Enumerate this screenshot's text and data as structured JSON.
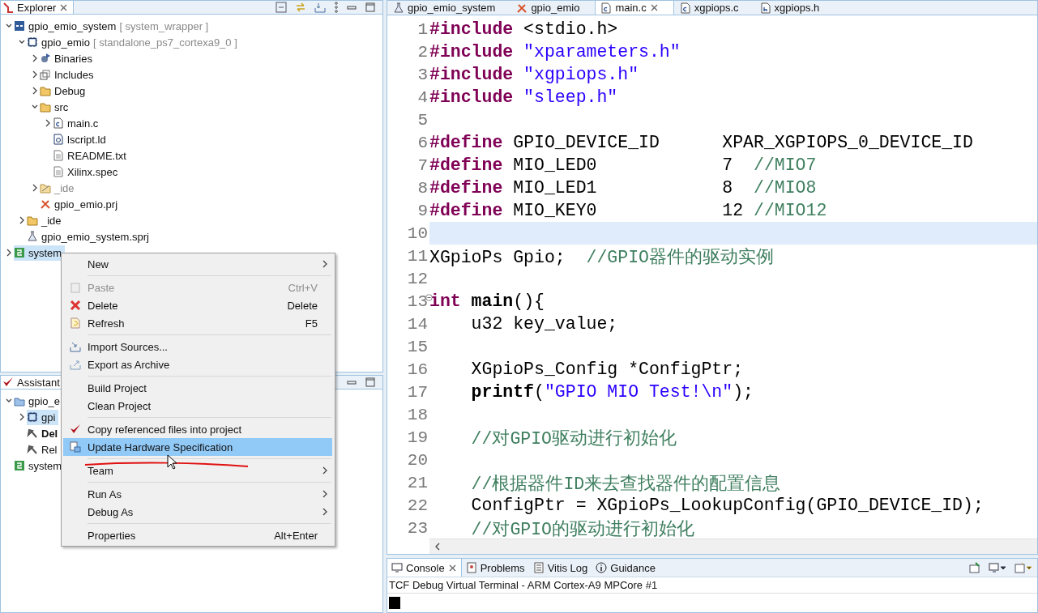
{
  "explorer": {
    "title": "Explorer",
    "tree": [
      {
        "label": "gpio_emio_system",
        "suffix": "[ system_wrapper ]",
        "kind": "system",
        "expanded": true,
        "selected": false,
        "children": [
          {
            "label": "gpio_emio",
            "suffix": "[ standalone_ps7_cortexa9_0 ]",
            "kind": "app",
            "expanded": true,
            "selected": false,
            "children": [
              {
                "label": "Binaries",
                "kind": "binaries",
                "expanded": false,
                "selected": false
              },
              {
                "label": "Includes",
                "kind": "includes",
                "expanded": false,
                "selected": false
              },
              {
                "label": "Debug",
                "kind": "folder",
                "expanded": false,
                "selected": false
              },
              {
                "label": "src",
                "kind": "folder",
                "expanded": true,
                "selected": false,
                "children": [
                  {
                    "label": "main.c",
                    "kind": "cfile",
                    "expanded": false,
                    "selected": false
                  },
                  {
                    "label": "lscript.ld",
                    "kind": "ldfile",
                    "selected": false
                  },
                  {
                    "label": "README.txt",
                    "kind": "textfile",
                    "selected": false
                  },
                  {
                    "label": "Xilinx.spec",
                    "kind": "textfile",
                    "selected": false
                  }
                ]
              },
              {
                "label": "_ide",
                "kind": "idefolder",
                "expanded": false,
                "selected": false
              },
              {
                "label": "gpio_emio.prj",
                "kind": "prj",
                "selected": false
              }
            ]
          },
          {
            "label": "_ide",
            "kind": "folder",
            "expanded": false,
            "selected": false
          },
          {
            "label": "gpio_emio_system.sprj",
            "kind": "sprj",
            "selected": false
          }
        ]
      },
      {
        "label": "system",
        "kind": "platform",
        "expanded": false,
        "selected": true
      }
    ]
  },
  "assistant": {
    "title": "Assistant",
    "tree": [
      {
        "label": "gpio_e",
        "kind": "sysproject",
        "expanded": true,
        "selected": false,
        "children": [
          {
            "label": "gpi",
            "kind": "app",
            "expanded": false,
            "selected": true
          },
          {
            "label": "Del",
            "kind": "config",
            "active": true,
            "selected": false
          },
          {
            "label": "Rel",
            "kind": "config",
            "active": false,
            "selected": false
          }
        ]
      },
      {
        "label": "system",
        "kind": "platform",
        "selected": false
      }
    ]
  },
  "context_menu": {
    "items": [
      {
        "kind": "item",
        "label": "New",
        "submenu": true,
        "disabled": false,
        "selected": false
      },
      {
        "kind": "separator"
      },
      {
        "kind": "item",
        "label": "Paste",
        "shortcut": "Ctrl+V",
        "disabled": true,
        "selected": false
      },
      {
        "kind": "item",
        "label": "Delete",
        "shortcut": "Delete",
        "disabled": false,
        "selected": false
      },
      {
        "kind": "item",
        "label": "Refresh",
        "shortcut": "F5",
        "disabled": false,
        "selected": false
      },
      {
        "kind": "separator"
      },
      {
        "kind": "item",
        "label": "Import Sources...",
        "disabled": false,
        "selected": false
      },
      {
        "kind": "item",
        "label": "Export as Archive",
        "disabled": false,
        "selected": false
      },
      {
        "kind": "separator"
      },
      {
        "kind": "item",
        "label": "Build Project",
        "disabled": false,
        "selected": false
      },
      {
        "kind": "item",
        "label": "Clean Project",
        "disabled": false,
        "selected": false
      },
      {
        "kind": "separator"
      },
      {
        "kind": "item",
        "label": "Copy referenced files into project",
        "disabled": false,
        "selected": false
      },
      {
        "kind": "item",
        "label": "Update Hardware Specification",
        "disabled": false,
        "selected": true
      },
      {
        "kind": "separator"
      },
      {
        "kind": "item",
        "label": "Team",
        "submenu": true,
        "disabled": false,
        "selected": false
      },
      {
        "kind": "separator"
      },
      {
        "kind": "item",
        "label": "Run As",
        "submenu": true,
        "disabled": false,
        "selected": false
      },
      {
        "kind": "item",
        "label": "Debug As",
        "submenu": true,
        "disabled": false,
        "selected": false
      },
      {
        "kind": "separator"
      },
      {
        "kind": "item",
        "label": "Properties",
        "shortcut": "Alt+Enter",
        "disabled": false,
        "selected": false
      }
    ]
  },
  "editor": {
    "tabs": [
      {
        "label": "gpio_emio_system",
        "kind": "sprj",
        "selected": false
      },
      {
        "label": "gpio_emio",
        "kind": "prj",
        "selected": false
      },
      {
        "label": "main.c",
        "kind": "cfile",
        "selected": true
      },
      {
        "label": "xgpiops.c",
        "kind": "cfile",
        "selected": false
      },
      {
        "label": "xgpiops.h",
        "kind": "hfile",
        "selected": false
      }
    ],
    "lines": [
      {
        "number": "1",
        "current": false,
        "tokens": [
          {
            "kind": "keyword",
            "text": "#include"
          },
          {
            "kind": "plain",
            "text": " <stdio.h>"
          }
        ]
      },
      {
        "number": "2",
        "current": false,
        "tokens": [
          {
            "kind": "keyword",
            "text": "#include"
          },
          {
            "kind": "string",
            "text": " \"xparameters.h\""
          }
        ]
      },
      {
        "number": "3",
        "current": false,
        "tokens": [
          {
            "kind": "keyword",
            "text": "#include"
          },
          {
            "kind": "string",
            "text": " \"xgpiops.h\""
          }
        ]
      },
      {
        "number": "4",
        "current": false,
        "tokens": [
          {
            "kind": "keyword",
            "text": "#include"
          },
          {
            "kind": "string",
            "text": " \"sleep.h\""
          }
        ]
      },
      {
        "number": "5",
        "current": false
      },
      {
        "number": "6",
        "current": false,
        "tokens": [
          {
            "kind": "keyword",
            "text": "#define"
          },
          {
            "kind": "plain",
            "text": " GPIO_DEVICE_ID      XPAR_XGPIOPS_0_DEVICE_ID"
          }
        ]
      },
      {
        "number": "7",
        "current": false,
        "tokens": [
          {
            "kind": "keyword",
            "text": "#define"
          },
          {
            "kind": "plain",
            "text": " MIO_LED0            7  "
          },
          {
            "kind": "comment",
            "text": "//MIO7"
          }
        ]
      },
      {
        "number": "8",
        "current": false,
        "tokens": [
          {
            "kind": "keyword",
            "text": "#define"
          },
          {
            "kind": "plain",
            "text": " MIO_LED1            8  "
          },
          {
            "kind": "comment",
            "text": "//MIO8"
          }
        ]
      },
      {
        "number": "9",
        "current": false,
        "tokens": [
          {
            "kind": "keyword",
            "text": "#define"
          },
          {
            "kind": "plain",
            "text": " MIO_KEY0            12 "
          },
          {
            "kind": "comment",
            "text": "//MIO12"
          }
        ]
      },
      {
        "number": "10",
        "current": true
      },
      {
        "number": "11",
        "current": false,
        "tokens": [
          {
            "kind": "plain",
            "text": "XGpioPs Gpio;  "
          },
          {
            "kind": "comment",
            "text": "//GPIO器件的驱动实例"
          }
        ]
      },
      {
        "number": "12",
        "current": false
      },
      {
        "number": "13",
        "current": false,
        "folded": false,
        "tokens": [
          {
            "kind": "keyword",
            "text": "int"
          },
          {
            "kind": "bold",
            "text": " main"
          },
          {
            "kind": "plain",
            "text": "(){"
          }
        ]
      },
      {
        "number": "14",
        "current": false,
        "tokens": [
          {
            "kind": "plain",
            "text": "    u32 key_value;"
          }
        ]
      },
      {
        "number": "15",
        "current": false
      },
      {
        "number": "16",
        "current": false,
        "tokens": [
          {
            "kind": "plain",
            "text": "    XGpioPs_Config *ConfigPtr;"
          }
        ]
      },
      {
        "number": "17",
        "current": false,
        "tokens": [
          {
            "kind": "bold",
            "text": "    printf"
          },
          {
            "kind": "plain",
            "text": "("
          },
          {
            "kind": "string",
            "text": "\"GPIO MIO Test!\\n\""
          },
          {
            "kind": "plain",
            "text": ");"
          }
        ]
      },
      {
        "number": "18",
        "current": false
      },
      {
        "number": "19",
        "current": false,
        "tokens": [
          {
            "kind": "comment",
            "text": "    //对GPIO驱动进行初始化"
          }
        ]
      },
      {
        "number": "20",
        "current": false
      },
      {
        "number": "21",
        "current": false,
        "tokens": [
          {
            "kind": "comment",
            "text": "    //根据器件ID来去查找器件的配置信息"
          }
        ]
      },
      {
        "number": "22",
        "current": false,
        "tokens": [
          {
            "kind": "plain",
            "text": "    ConfigPtr = XGpioPs_LookupConfig(GPIO_DEVICE_ID);"
          }
        ]
      },
      {
        "number": "23",
        "current": false,
        "tokens": [
          {
            "kind": "comment",
            "text": "    //对GPIO的驱动进行初始化"
          }
        ]
      }
    ]
  },
  "console": {
    "tabs": [
      {
        "label": "Console",
        "kind": "console",
        "selected": true
      },
      {
        "label": "Problems",
        "kind": "problems",
        "selected": false
      },
      {
        "label": "Vitis Log",
        "kind": "log",
        "selected": false
      },
      {
        "label": "Guidance",
        "kind": "info",
        "selected": false
      }
    ],
    "terminal_title": "TCF Debug Virtual Terminal - ARM Cortex-A9 MPCore #1"
  }
}
